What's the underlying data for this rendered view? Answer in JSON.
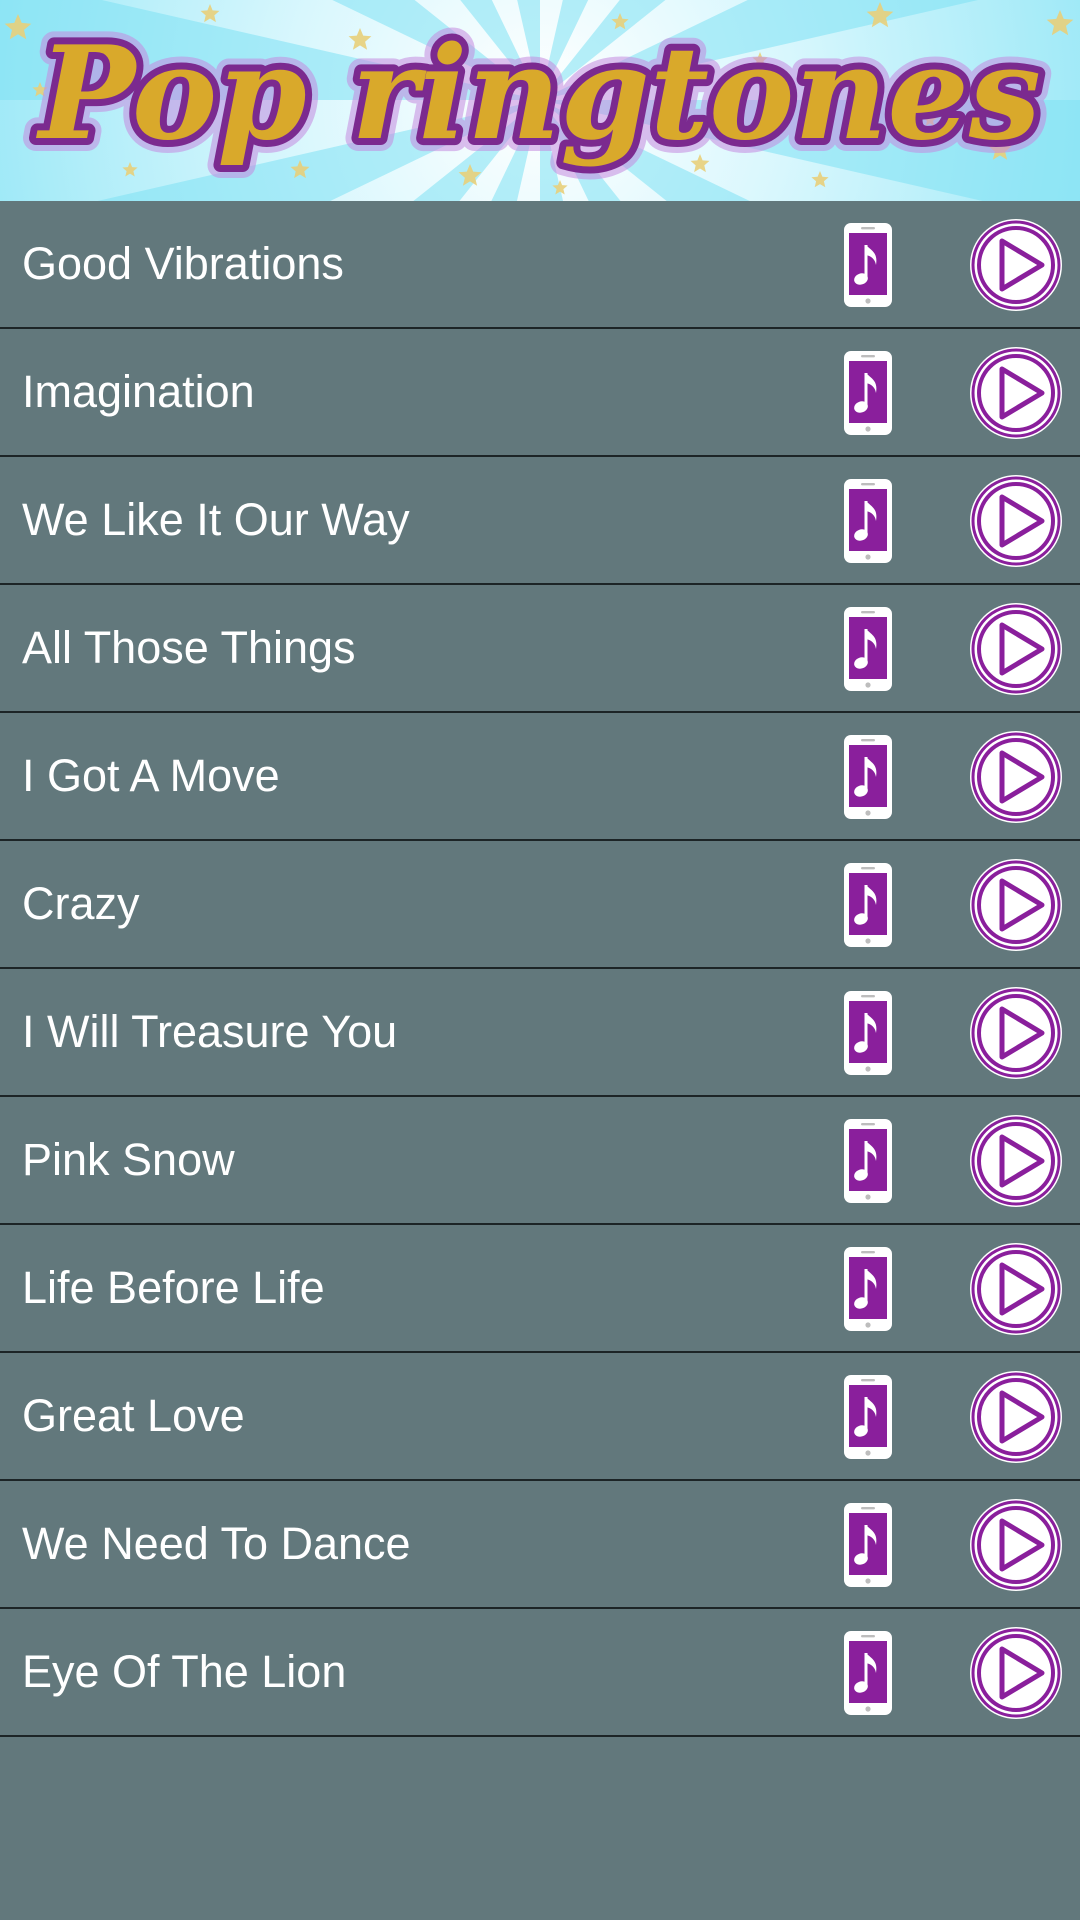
{
  "header": {
    "title": "Pop ringtones"
  },
  "colors": {
    "background": "#62787c",
    "row_divider": "#1c2426",
    "text": "#ffffff",
    "accent_purple": "#8a1f9c",
    "title_gold": "#d9a92b",
    "title_outline": "#7b2a8f",
    "banner_light": "#dff9ff",
    "banner_cyan": "#86e6f6"
  },
  "icons": {
    "ringtone": "phone-music-note-icon",
    "play": "play-circle-icon"
  },
  "songs": [
    {
      "title": "Good Vibrations"
    },
    {
      "title": "Imagination"
    },
    {
      "title": "We Like It Our Way"
    },
    {
      "title": "All Those Things"
    },
    {
      "title": "I Got A Move"
    },
    {
      "title": "Crazy"
    },
    {
      "title": "I Will Treasure You"
    },
    {
      "title": "Pink Snow"
    },
    {
      "title": "Life Before Life"
    },
    {
      "title": "Great Love"
    },
    {
      "title": "We Need To Dance"
    },
    {
      "title": "Eye Of The Lion"
    }
  ]
}
